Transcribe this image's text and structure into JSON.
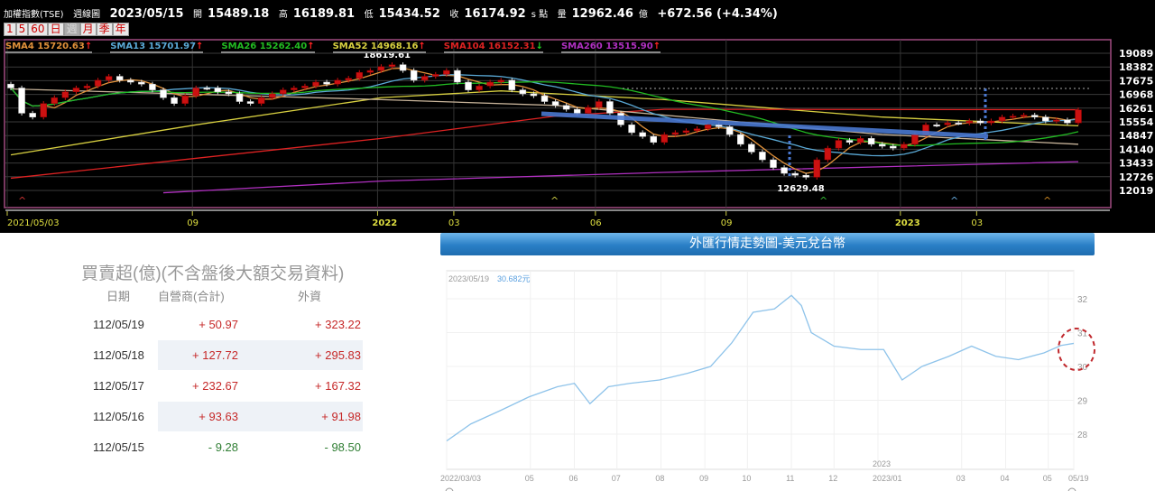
{
  "header": {
    "name": "加權指數(TSE)",
    "period_type": "週線圖",
    "date": "2023/05/15",
    "open_label": "開",
    "open": "15489.18",
    "high_label": "高",
    "high": "16189.81",
    "low_label": "低",
    "low": "15434.52",
    "close_label": "收",
    "close": "16174.92",
    "close_unit": "s 點",
    "volume_label": "量",
    "volume": "12962.46",
    "volume_unit": "億",
    "change": "+672.56 (+4.34%)"
  },
  "periods": [
    "1",
    "5",
    "60",
    "日",
    "週",
    "月",
    "季",
    "年"
  ],
  "selected_period": "週",
  "colors": {
    "up": "#cc1111",
    "down": "#ffffff",
    "sma4": "#e0913a",
    "sma13": "#5aa9d6",
    "sma26": "#22bb22",
    "sma52": "#d8d040",
    "sma104": "#dd2222",
    "sma260": "#b030c0",
    "unlabeled": "#c8b49a",
    "trend": "#4a78d0"
  },
  "chart_data": [
    {
      "type": "candlestick",
      "title": "加權指數(TSE) 週線圖",
      "legend": [
        {
          "key": "sma4",
          "label": "SMA4 15720.63",
          "dir": "up"
        },
        {
          "key": "sma13",
          "label": "SMA13 15701.97",
          "dir": "up"
        },
        {
          "key": "sma26",
          "label": "SMA26 15262.40",
          "dir": "up"
        },
        {
          "key": "sma52",
          "label": "SMA52 14968.16",
          "dir": "up"
        },
        {
          "key": "sma104",
          "label": "SMA104 16152.31",
          "dir": "down"
        },
        {
          "key": "sma260",
          "label": "SMA260 13515.90",
          "dir": "up"
        }
      ],
      "y_ticks": [
        19089,
        18382,
        17675,
        16968,
        16261,
        15554,
        14847,
        14140,
        13433,
        12726,
        12019
      ],
      "ylim": [
        11800,
        19300
      ],
      "x_ticks": [
        {
          "label": "2021/05/03",
          "i": 0,
          "bold": false
        },
        {
          "label": "09",
          "i": 17,
          "bold": false
        },
        {
          "label": "2022",
          "i": 34,
          "bold": true
        },
        {
          "label": "03",
          "i": 41,
          "bold": false
        },
        {
          "label": "06",
          "i": 54,
          "bold": false
        },
        {
          "label": "09",
          "i": 66,
          "bold": false
        },
        {
          "label": "2023",
          "i": 82,
          "bold": true
        },
        {
          "label": "03",
          "i": 89,
          "bold": false
        }
      ],
      "first_open": 17500,
      "closes": [
        17300,
        16000,
        15800,
        16500,
        16800,
        17100,
        17300,
        17400,
        17700,
        17900,
        17700,
        17600,
        17500,
        17200,
        16800,
        16500,
        16900,
        17300,
        17300,
        17100,
        17000,
        16600,
        16500,
        16800,
        17000,
        17200,
        17300,
        17400,
        17600,
        17500,
        17700,
        17800,
        18100,
        18200,
        18400,
        18500,
        18200,
        17700,
        17900,
        18000,
        18200,
        17600,
        17200,
        17400,
        17600,
        17700,
        17200,
        17000,
        16900,
        16600,
        16400,
        16200,
        16000,
        16300,
        16600,
        16000,
        15400,
        15000,
        14800,
        14500,
        14900,
        15000,
        15100,
        15200,
        15400,
        15300,
        14900,
        14400,
        14000,
        13600,
        13200,
        12900,
        12800,
        12700,
        13600,
        14200,
        14600,
        14500,
        14700,
        14400,
        14300,
        14200,
        14400,
        14900,
        15400,
        15400,
        15500,
        15500,
        15600,
        15500,
        15600,
        15800,
        15850,
        15900,
        15800,
        15600,
        15650,
        15500,
        16175
      ],
      "long_mas": {
        "sma52": [
          [
            0,
            13850
          ],
          [
            17,
            15400
          ],
          [
            34,
            16800
          ],
          [
            45,
            17150
          ],
          [
            60,
            16700
          ],
          [
            80,
            15800
          ],
          [
            98,
            15350
          ]
        ],
        "sma104": [
          [
            0,
            12650
          ],
          [
            34,
            14700
          ],
          [
            50,
            15850
          ],
          [
            60,
            16200
          ],
          [
            98,
            16180
          ]
        ],
        "sma260": [
          [
            14,
            11900
          ],
          [
            34,
            12500
          ],
          [
            60,
            12950
          ],
          [
            98,
            13500
          ]
        ],
        "unlabeled": [
          [
            0,
            17250
          ],
          [
            34,
            16700
          ],
          [
            50,
            16400
          ],
          [
            80,
            14900
          ],
          [
            98,
            14400
          ]
        ]
      },
      "annotations": [
        {
          "label": "18619.61",
          "i": 35,
          "value": 18619.61
        },
        {
          "label": "12629.48",
          "i": 73,
          "value": 12629.48
        }
      ]
    },
    {
      "type": "line",
      "title": "外匯行情走勢圖-美元兌台幣",
      "readout_date": "2023/05/19",
      "readout_value": "30.682元",
      "y_ticks": [
        28,
        29,
        30,
        31,
        32
      ],
      "ylim": [
        27.6,
        32.9
      ],
      "x_ticks": [
        "2022/03/03",
        "05",
        "06",
        "07",
        "08",
        "09",
        "10",
        "11",
        "12",
        "2023/01",
        "03",
        "04",
        "05",
        "05/19"
      ],
      "x_tick_dates": [
        "2022-03-03",
        "2022-05-01",
        "2022-06-01",
        "2022-07-01",
        "2022-08-01",
        "2022-09-01",
        "2022-10-01",
        "2022-11-01",
        "2022-12-01",
        "2023-01-01",
        "2023-03-01",
        "2023-04-01",
        "2023-05-01",
        "2023-05-19"
      ],
      "year_label": "2023",
      "points": [
        [
          "2022-03-03",
          27.8
        ],
        [
          "2022-03-20",
          28.3
        ],
        [
          "2022-04-10",
          28.7
        ],
        [
          "2022-04-30",
          29.1
        ],
        [
          "2022-05-20",
          29.4
        ],
        [
          "2022-06-01",
          29.5
        ],
        [
          "2022-06-12",
          28.9
        ],
        [
          "2022-06-25",
          29.4
        ],
        [
          "2022-07-10",
          29.5
        ],
        [
          "2022-07-31",
          29.6
        ],
        [
          "2022-08-20",
          29.8
        ],
        [
          "2022-09-05",
          30.0
        ],
        [
          "2022-09-20",
          30.7
        ],
        [
          "2022-10-05",
          31.6
        ],
        [
          "2022-10-20",
          31.7
        ],
        [
          "2022-11-01",
          32.1
        ],
        [
          "2022-11-08",
          31.8
        ],
        [
          "2022-11-15",
          31.0
        ],
        [
          "2022-12-01",
          30.6
        ],
        [
          "2022-12-20",
          30.5
        ],
        [
          "2023-01-05",
          30.5
        ],
        [
          "2023-01-18",
          29.6
        ],
        [
          "2023-02-01",
          30.0
        ],
        [
          "2023-02-20",
          30.3
        ],
        [
          "2023-03-08",
          30.6
        ],
        [
          "2023-03-25",
          30.3
        ],
        [
          "2023-04-10",
          30.2
        ],
        [
          "2023-04-28",
          30.4
        ],
        [
          "2023-05-10",
          30.62
        ],
        [
          "2023-05-19",
          30.682
        ]
      ]
    }
  ],
  "trading_table": {
    "title": "買賣超(億)(不含盤後大額交易資料)",
    "headers": [
      "日期",
      "自營商(合計)",
      "外資"
    ],
    "rows": [
      {
        "date": "112/05/19",
        "dealer": "+ 50.97",
        "foreign": "+ 323.22",
        "dir": "up"
      },
      {
        "date": "112/05/18",
        "dealer": "+ 127.72",
        "foreign": "+ 295.83",
        "dir": "up"
      },
      {
        "date": "112/05/17",
        "dealer": "+ 232.67",
        "foreign": "+ 167.32",
        "dir": "up"
      },
      {
        "date": "112/05/16",
        "dealer": "+ 93.63",
        "foreign": "+ 91.98",
        "dir": "up"
      },
      {
        "date": "112/05/15",
        "dealer": "- 9.28",
        "foreign": "- 98.50",
        "dir": "down"
      }
    ]
  }
}
